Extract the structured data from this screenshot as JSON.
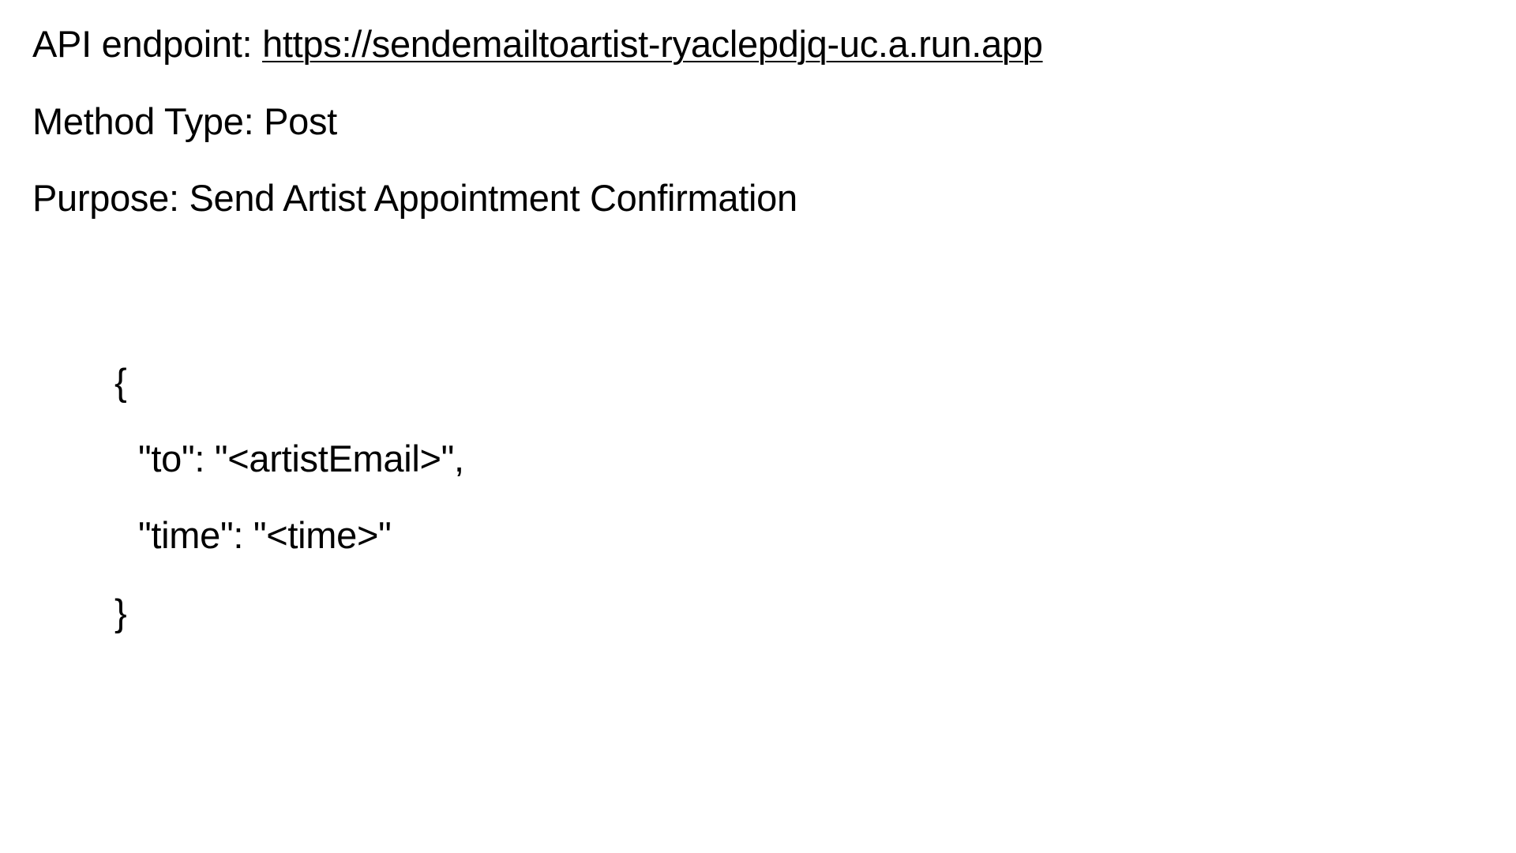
{
  "doc": {
    "endpoint_label": "API endpoint: ",
    "endpoint_url": "https://sendemailtoartist-ryaclepdjq-uc.a.run.app",
    "method_line": "Method Type: Post",
    "purpose_line": "Purpose: Send Artist Appointment Confirmation"
  },
  "body_example": {
    "open_brace": "{",
    "to_line": "\"to\": \"<artistEmail>\",",
    "time_line": "\"time\": \"<time>\"",
    "close_brace": "}"
  }
}
